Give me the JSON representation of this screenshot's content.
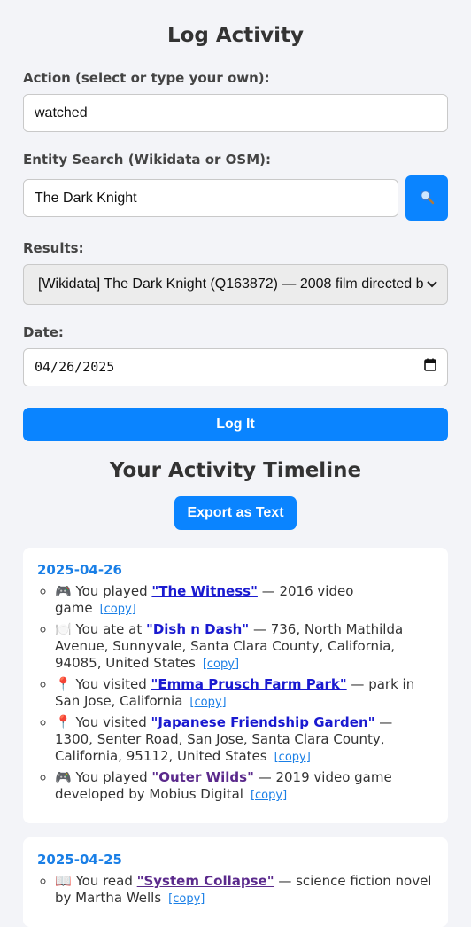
{
  "page_title": "Log Activity",
  "action": {
    "label": "Action (select or type your own):",
    "value": "watched"
  },
  "entity_search": {
    "label": "Entity Search (Wikidata or OSM):",
    "value": "The Dark Knight",
    "button_icon": "magnifier-icon"
  },
  "results": {
    "label": "Results:",
    "selected": "[Wikidata] The Dark Knight (Q163872) — 2008 film directed b"
  },
  "date": {
    "label": "Date:",
    "value": "04/26/2025"
  },
  "log_button": "Log It",
  "timeline_title": "Your Activity Timeline",
  "export_button": "Export as Text",
  "copy_label": "[copy]",
  "days": [
    {
      "date": "2025-04-26",
      "items": [
        {
          "icon": "🎮",
          "prefix": "You played",
          "entity": "\"The Witness\"",
          "desc": "— 2016 video game",
          "visited": false
        },
        {
          "icon": "🍽️",
          "prefix": "You ate at",
          "entity": "\"Dish n Dash\"",
          "desc": "— 736, North Mathilda Avenue, Sunnyvale, Santa Clara County, California, 94085, United States",
          "visited": false
        },
        {
          "icon": "📍",
          "prefix": "You visited",
          "entity": "\"Emma Prusch Farm Park\"",
          "desc": "— park in San Jose, California",
          "visited": false
        },
        {
          "icon": "📍",
          "prefix": "You visited",
          "entity": "\"Japanese Friendship Garden\"",
          "desc": "— 1300, Senter Road, San Jose, Santa Clara County, California, 95112, United States",
          "visited": false
        },
        {
          "icon": "🎮",
          "prefix": "You played",
          "entity": "\"Outer Wilds\"",
          "desc": "— 2019 video game developed by Mobius Digital",
          "visited": true
        }
      ]
    },
    {
      "date": "2025-04-25",
      "items": [
        {
          "icon": "📖",
          "prefix": "You read",
          "entity": "\"System Collapse\"",
          "desc": "— science fiction novel by Martha Wells",
          "visited": true
        }
      ]
    }
  ]
}
